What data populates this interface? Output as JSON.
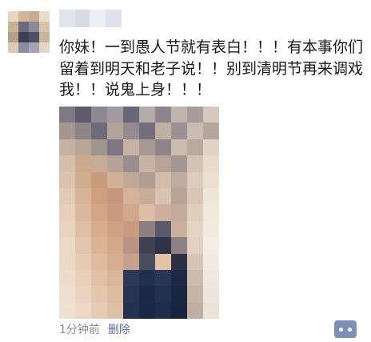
{
  "post": {
    "text": "你妹！一到愚人节就有表白！！！有本事你们留着到明天和老子说！！别到清明节再来调戏我！！说鬼上身！！！",
    "time": "1分钟前",
    "delete_label": "删除"
  },
  "colors": {
    "link": "#576b95",
    "meta_gray": "#8a8a8a",
    "comment_button": "#7f90b6"
  },
  "icons": {
    "comment": "more-actions-icon"
  }
}
